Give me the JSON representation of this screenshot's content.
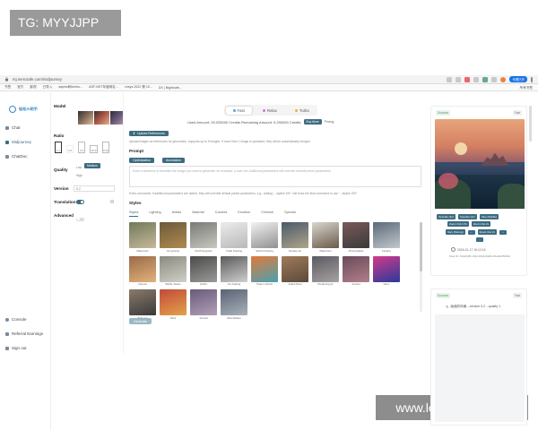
{
  "watermark_top": "TG: MYYJJPP",
  "watermark_bottom": "www.longduote.com",
  "browser": {
    "url": "mj.mercsafe.com/midjourney",
    "profile_button": "代理已开",
    "bookmarks": [
      "书签",
      "官方",
      "影视",
      "已导入",
      "aspine和kimhu...",
      "ASF-NET年度网址...",
      "Lesys 2022 第 10...",
      "DX | Nightcafe..."
    ],
    "all_bookmarks": "所有书签"
  },
  "sidebar": {
    "logo_text": "轻松AI助手",
    "nav": [
      {
        "label": "Chat",
        "icon": "chat-icon"
      },
      {
        "label": "Midjourney",
        "icon": "image-icon"
      },
      {
        "label": "ChatDoc",
        "icon": "doc-icon"
      }
    ],
    "bottom": [
      {
        "label": "Console",
        "icon": "console-icon"
      },
      {
        "label": "Referral Earnings",
        "icon": "gift-icon"
      },
      {
        "label": "Sign out",
        "icon": "signout-icon"
      }
    ]
  },
  "settings": {
    "model_label": "Model",
    "ratio_label": "Ratio",
    "ratios": [
      "1:1",
      "4:3",
      "3:4",
      "16:9",
      "9:16"
    ],
    "quality_label": "Quality",
    "quality_options": [
      "Low",
      "Medium",
      "High"
    ],
    "quality_selected": "Medium",
    "version_label": "Version",
    "version_value": "5.2",
    "translation_label": "Translation",
    "advanced_label": "Advanced"
  },
  "main": {
    "modes": [
      {
        "label": "Fast",
        "color": "#4fa3e3"
      },
      {
        "label": "Relax",
        "color": "#c77ad6"
      },
      {
        "label": "Turbo",
        "color": "#e5b43a"
      }
    ],
    "usage_text": "Used Amount: 25.025000 Credits Remaining Amount: 0.250000 Credits",
    "buy_more": "Buy More",
    "pricing": "Pricing",
    "upload_button": "Upload References",
    "upload_hint": "Upload images as references for generation, supports up to 5 images. If more than 1 image is uploaded, they will be automatically merged.",
    "prompt_label": "Prompt",
    "prompt_buttons": [
      "Optimization",
      "Annotation"
    ],
    "prompt_placeholder": "Enter a sentence to describe the image you want to generate, for example: a cute cat. Additional parameters will override default preset parameters",
    "params_hint": "Enter comments, if additional parameters are added, they will override default preset parameters, e.g., adding ' --stylize 200 ' will force the final command to use ' --stylize 200'",
    "styles_label": "Styles",
    "style_tabs": [
      "Styles",
      "Lighting",
      "Artists",
      "Material",
      "Camera",
      "Emotion",
      "Chinese",
      "Special"
    ],
    "style_items": [
      {
        "label": "Watercolor",
        "colors": [
          "#6f7a5a",
          "#c9b89a"
        ]
      },
      {
        "label": "Oil painting",
        "colors": [
          "#6b5a3a",
          "#b08a50"
        ]
      },
      {
        "label": "Old Photograph",
        "colors": [
          "#7a7a76",
          "#c8c8c0"
        ]
      },
      {
        "label": "Chalk Drawing",
        "colors": [
          "#ececec",
          "#b8b8b8"
        ]
      },
      {
        "label": "Sketch Drawing",
        "colors": [
          "#f2f2f2",
          "#909090"
        ]
      },
      {
        "label": "Fantasy art",
        "colors": [
          "#4a5a6a",
          "#b0a48a"
        ]
      },
      {
        "label": "Watercolor",
        "colors": [
          "#d9d6cf",
          "#6a5a4a"
        ]
      },
      {
        "label": "Photorealistic",
        "colors": [
          "#7a5a5a",
          "#3a3a3a"
        ]
      },
      {
        "label": "Fantasy",
        "colors": [
          "#5a6a7a",
          "#c2c8cc"
        ]
      },
      {
        "label": "Cartoon",
        "colors": [
          "#9a6a4a",
          "#e2b27a"
        ]
      },
      {
        "label": "Marble Statue",
        "colors": [
          "#8a8a80",
          "#d0d0c8"
        ]
      },
      {
        "label": "Gothic",
        "colors": [
          "#4a4a4a",
          "#9a9a98"
        ]
      },
      {
        "label": "Ink drawing",
        "colors": [
          "#5a5a5a",
          "#cfcfcf"
        ]
      },
      {
        "label": "Paper cutcraft",
        "colors": [
          "#e27a3a",
          "#4aa0b0"
        ]
      },
      {
        "label": "Felted Wool",
        "colors": [
          "#a07a5a",
          "#5a4a3a"
        ]
      },
      {
        "label": "Rendering art",
        "colors": [
          "#5a5a62",
          "#a8a2a0"
        ]
      },
      {
        "label": "Ancient",
        "colors": [
          "#6a4a5a",
          "#b0808a"
        ]
      },
      {
        "label": "Neon",
        "colors": [
          "#d23a8a",
          "#2a3a9a"
        ]
      },
      {
        "label": "Ballpoint",
        "colors": [
          "#8a7a6a",
          "#3a3a3a"
        ]
      },
      {
        "label": "Paint",
        "colors": [
          "#c24a3a",
          "#e2a24a"
        ]
      },
      {
        "label": "Surreal",
        "colors": [
          "#6a5a7a",
          "#b0a0b8"
        ]
      },
      {
        "label": "Ultra Modern",
        "colors": [
          "#5a6272",
          "#aab2bc"
        ]
      }
    ],
    "submit": "Generate"
  },
  "right_panel": {
    "card1": {
      "status": "Success",
      "tag": "Fast",
      "actions_row1": [
        "Upscale (2x)",
        "Upscale (4x)",
        "Vary (Subtle)"
      ],
      "actions_row2": [
        "Zoom Out 1.5x",
        "Zoom Out 2x"
      ],
      "actions_row3": [
        "Vary (Strong)",
        "Zoom Out 2x"
      ],
      "row3_squares": [
        "←",
        "→"
      ],
      "row4_square": "↑",
      "timestamp": "2024-01-17 16:12:16",
      "task_id": "Task ID: 61fe0325-c492-45d4-8a99-c0be8a786334"
    },
    "card2": {
      "status": "Success",
      "tag": "Fast",
      "prompt": "画面的风格 --version 5.2 --quality 1"
    }
  }
}
